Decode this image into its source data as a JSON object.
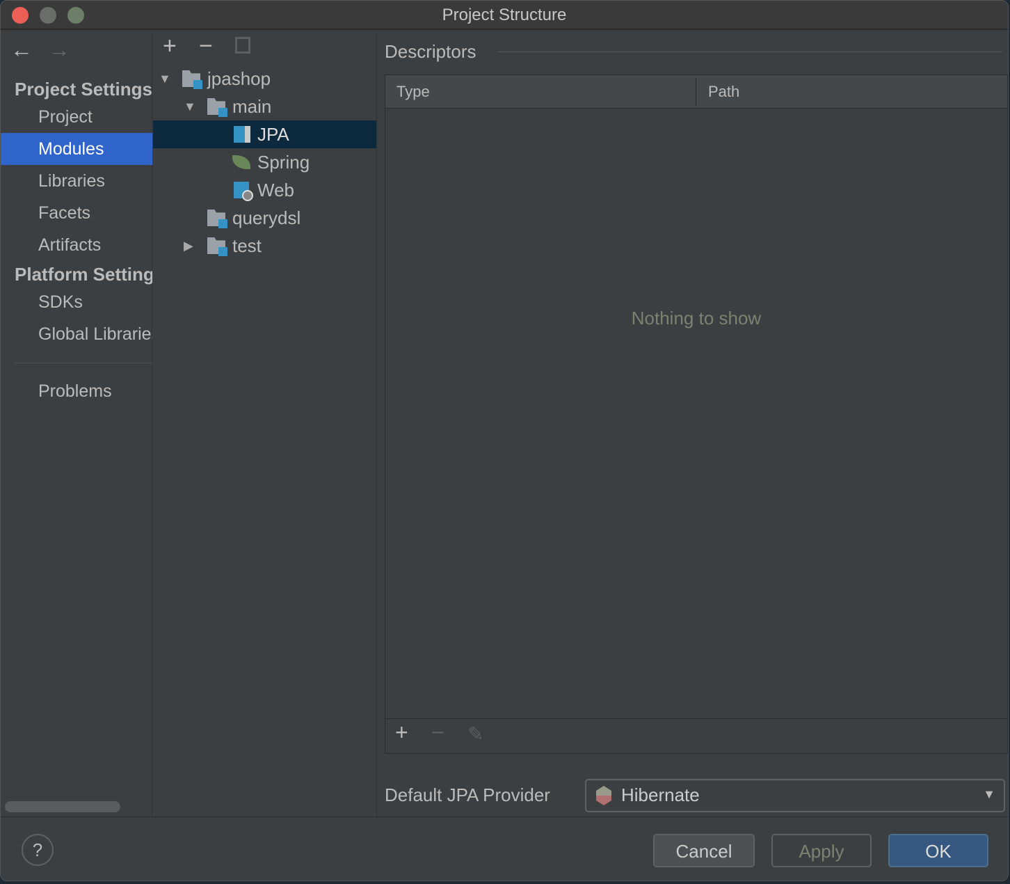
{
  "window": {
    "title": "Project Structure"
  },
  "sidebar": {
    "section1": "Project Settings",
    "items1": [
      "Project",
      "Modules",
      "Libraries",
      "Facets",
      "Artifacts"
    ],
    "section2": "Platform Settings",
    "items2": [
      "SDKs",
      "Global Libraries"
    ],
    "problems": "Problems"
  },
  "tree": {
    "nodes": [
      "jpashop",
      "main",
      "JPA",
      "Spring",
      "Web",
      "querydsl",
      "test"
    ]
  },
  "descriptors": {
    "title": "Descriptors",
    "columns": [
      "Type",
      "Path"
    ],
    "empty": "Nothing to show"
  },
  "provider": {
    "label": "Default JPA Provider",
    "value": "Hibernate"
  },
  "buttons": {
    "help": "?",
    "cancel": "Cancel",
    "apply": "Apply",
    "ok": "OK"
  },
  "colors": {
    "selection": "#2f65ca",
    "ok": "#365880"
  }
}
